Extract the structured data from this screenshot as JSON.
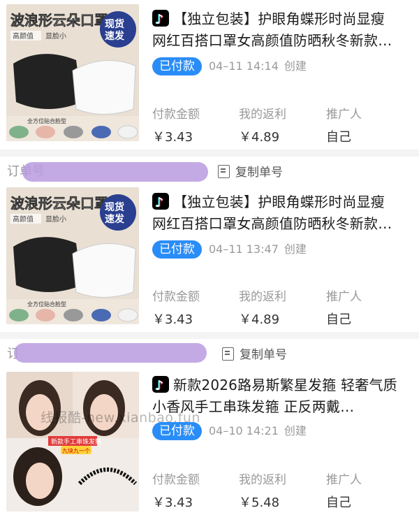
{
  "orders": [
    {
      "image_text": {
        "headline": "波浪形云朵口罩",
        "tag1": "高颜值",
        "tag2": "显脸小",
        "promo": "现货速发",
        "footer": "全方位贴合脸型"
      },
      "title_line1": "【独立包装】护眼角蝶形时尚显瘦",
      "title_line2": "网红百搭口罩女高颜值防晒秋冬新款…",
      "status": "已付款",
      "time": "04–11 14:14",
      "time_suffix": "创建",
      "amount_label": "付款金额",
      "amount": "￥3.43",
      "rebate_label": "我的返利",
      "rebate": "￥4.89",
      "promoter_label": "推广人",
      "promoter": "自己"
    },
    {
      "image_text": {
        "headline": "波浪形云朵口罩",
        "tag1": "高颜值",
        "tag2": "显脸小",
        "promo": "现货速发",
        "footer": "全方位贴合脸型"
      },
      "title_line1": "【独立包装】护眼角蝶形时尚显瘦",
      "title_line2": "网红百搭口罩女高颜值防晒秋冬新款…",
      "status": "已付款",
      "time": "04–11 13:47",
      "time_suffix": "创建",
      "amount_label": "付款金额",
      "amount": "￥3.43",
      "rebate_label": "我的返利",
      "rebate": "￥4.89",
      "promoter_label": "推广人",
      "promoter": "自己"
    },
    {
      "image_text": {
        "banner": "新款手工串珠发箍",
        "tag": "九块九一个"
      },
      "title_line1": "新款2026路易斯繁星发箍 轻奢气质",
      "title_line2": "小香风手工串珠发箍 正反两戴…",
      "status": "已付款",
      "time": "04–10 14:21",
      "time_suffix": "创建",
      "amount_label": "付款金额",
      "amount": "￥3.43",
      "rebate_label": "我的返利",
      "rebate": "￥5.48",
      "promoter_label": "推广人",
      "promoter": "自己"
    }
  ],
  "id_label": "订单号",
  "id_label_partial": "订",
  "copy_label": "复制单号",
  "watermark": "线报酷-new.xianbao.fun",
  "colors": {
    "badge": "#2a8df7",
    "smudge": "#b89be0",
    "divider": "#f4f4f4"
  }
}
